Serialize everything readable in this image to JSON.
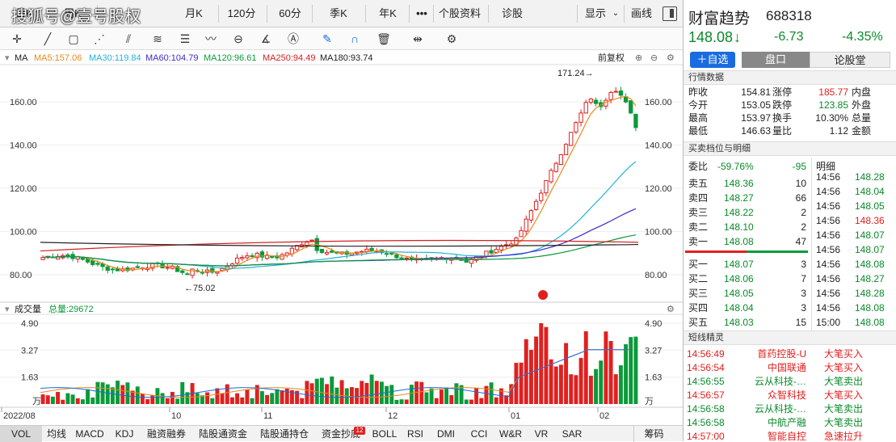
{
  "watermark": "搜狐号@壹号股权",
  "periods": [
    "日K",
    "周K",
    "月K",
    "120分",
    "60分",
    "季K",
    "年K"
  ],
  "more": "•••",
  "top_tabs": [
    "个股资料",
    "诊股"
  ],
  "display_label": "显示",
  "draw_label": "画线",
  "ma_bar": {
    "label": "MA",
    "ma5": "MA5:157.06",
    "ma30": "MA30:119.84",
    "ma60": "MA60:104.79",
    "ma120": "MA120:96.61",
    "ma250": "MA250:94.49",
    "ma180": "MA180:93.74",
    "adjust": "前复权"
  },
  "price_axis": [
    "160.00",
    "140.00",
    "120.00",
    "100.00",
    "80.00"
  ],
  "annotations": {
    "high": "171.24→",
    "low": "←75.02"
  },
  "vol_bar": {
    "label": "成交量",
    "total": "总量:29672"
  },
  "vol_axis": [
    "4.90",
    "3.27",
    "1.63",
    "万"
  ],
  "x_labels": [
    "2022/08",
    "10",
    "11",
    "12",
    "01",
    "02"
  ],
  "bottom_tabs": [
    "VOL",
    "均线",
    "MACD",
    "KDJ",
    "融资融券",
    "陆股通资金",
    "陆股通持仓",
    "资金抄底",
    "BOLL",
    "RSI",
    "DMI",
    "CCI",
    "W&R",
    "VR",
    "SAR"
  ],
  "bottom_badge": "12",
  "chips_label": "筹码",
  "stock": {
    "name": "财富趋势",
    "code": "688318",
    "price": "148.08",
    "arrow": "↓",
    "change": "-6.73",
    "pct": "-4.35%"
  },
  "rp_tabs": {
    "add": "＋自选",
    "pankou": "盘口",
    "forum": "论股堂"
  },
  "quote_title": "行情数据",
  "quote": [
    {
      "l1": "昨收",
      "v1": "154.81",
      "l2": "涨停",
      "v2": "185.77",
      "l3": "内盘"
    },
    {
      "l1": "今开",
      "v1": "153.05",
      "l2": "跌停",
      "v2": "123.85",
      "l3": "外盘"
    },
    {
      "l1": "最高",
      "v1": "153.97",
      "l2": "换手",
      "v2": "10.30%",
      "l3": "总量"
    },
    {
      "l1": "最低",
      "v1": "146.63",
      "l2": "量比",
      "v2": "1.12",
      "l3": "金额"
    }
  ],
  "ob_title": "买卖档位与明细",
  "weibi": {
    "label": "委比",
    "pct": "-59.76%",
    "diff": "-95"
  },
  "sells": [
    {
      "label": "卖五",
      "price": "148.36",
      "vol": "10"
    },
    {
      "label": "卖四",
      "price": "148.27",
      "vol": "66"
    },
    {
      "label": "卖三",
      "price": "148.22",
      "vol": "2"
    },
    {
      "label": "卖二",
      "price": "148.10",
      "vol": "2"
    },
    {
      "label": "卖一",
      "price": "148.08",
      "vol": "47"
    }
  ],
  "buys": [
    {
      "label": "买一",
      "price": "148.07",
      "vol": "3"
    },
    {
      "label": "买二",
      "price": "148.06",
      "vol": "7"
    },
    {
      "label": "买三",
      "price": "148.05",
      "vol": "3"
    },
    {
      "label": "买四",
      "price": "148.04",
      "vol": "3"
    },
    {
      "label": "买五",
      "price": "148.03",
      "vol": "15"
    }
  ],
  "detail_title": "明细",
  "details": [
    {
      "t": "14:56",
      "p": "148.28",
      "c": "green"
    },
    {
      "t": "14:56",
      "p": "148.04",
      "c": "green"
    },
    {
      "t": "14:56",
      "p": "148.05",
      "c": "green"
    },
    {
      "t": "14:56",
      "p": "148.36",
      "c": "red"
    },
    {
      "t": "14:56",
      "p": "148.07",
      "c": "green"
    },
    {
      "t": "14:56",
      "p": "148.07",
      "c": "green"
    },
    {
      "t": "14:56",
      "p": "148.08",
      "c": "green"
    },
    {
      "t": "14:56",
      "p": "148.27",
      "c": "green"
    },
    {
      "t": "14:56",
      "p": "148.28",
      "c": "green"
    },
    {
      "t": "14:56",
      "p": "148.08",
      "c": "green"
    },
    {
      "t": "15:00",
      "p": "148.08",
      "c": "green"
    }
  ],
  "sp_title": "短线精灵",
  "spirit": [
    {
      "t": "14:56:49",
      "name": "首药控股-U",
      "ev": "大笔买入",
      "c": "red"
    },
    {
      "t": "14:56:54",
      "name": "中国联通",
      "ev": "大笔买入",
      "c": "red"
    },
    {
      "t": "14:56:55",
      "name": "云从科技-…",
      "ev": "大笔卖出",
      "c": "green"
    },
    {
      "t": "14:56:57",
      "name": "众智科技",
      "ev": "大笔买入",
      "c": "red"
    },
    {
      "t": "14:56:58",
      "name": "云从科技-…",
      "ev": "大笔卖出",
      "c": "green"
    },
    {
      "t": "14:56:58",
      "name": "中航产融",
      "ev": "大笔卖出",
      "c": "green"
    },
    {
      "t": "14:57:00",
      "name": "智能自控",
      "ev": "急速拉升",
      "c": "red"
    }
  ]
}
